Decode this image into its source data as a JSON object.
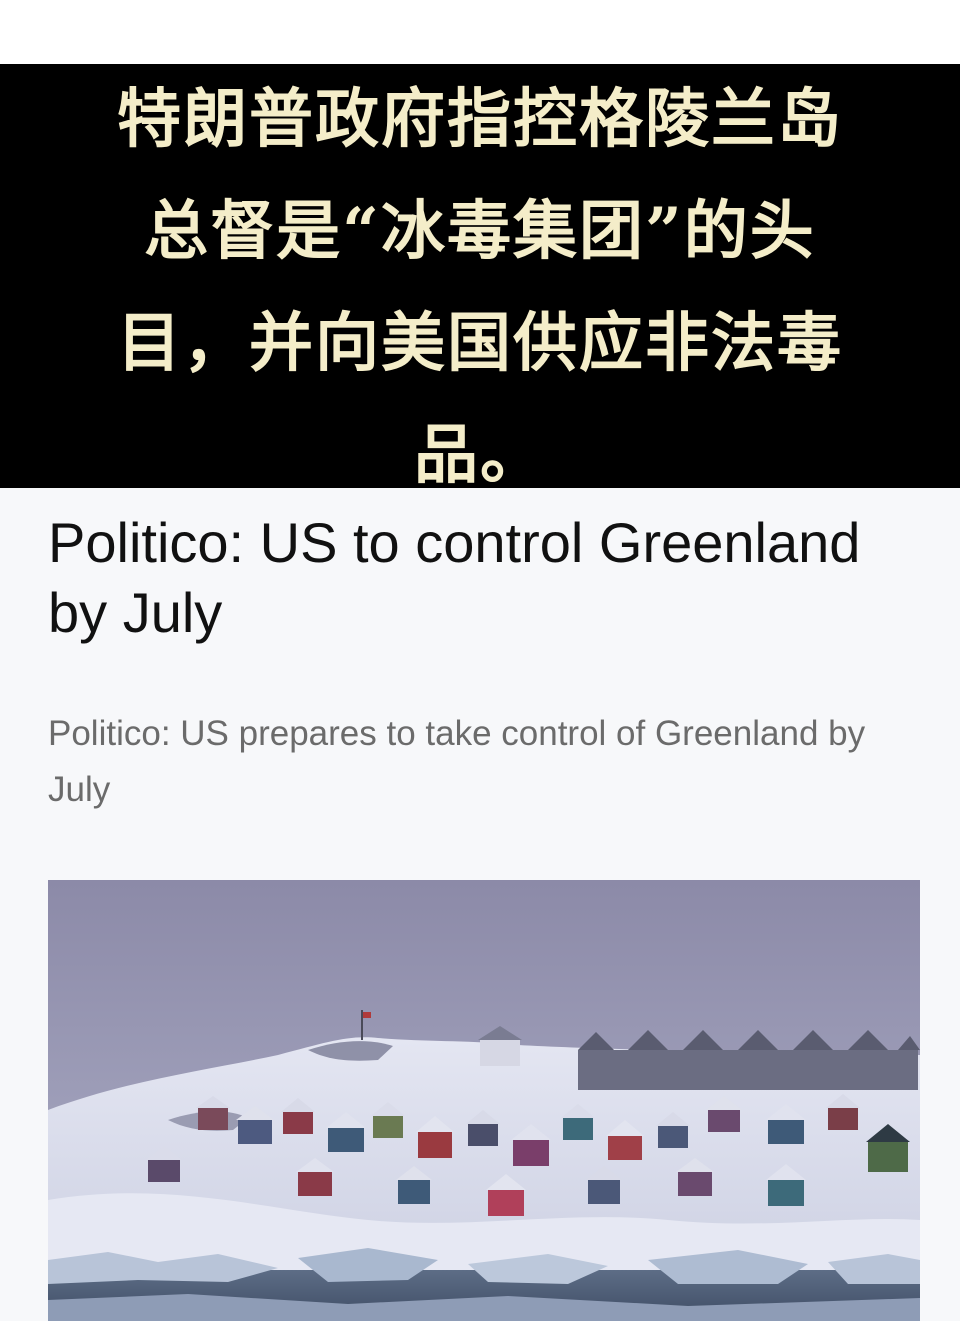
{
  "caption": {
    "lines": [
      "特朗普政府指控格陵兰岛",
      "总督是“冰毒集团”的头",
      "目，并向美国供应非法毒",
      "品。"
    ],
    "text_color": "#f4edc9",
    "background": "#000000"
  },
  "article": {
    "headline": "Politico: US to control Greenland by July",
    "subheadline": "Politico: US prepares to take control of Greenland by July"
  },
  "photo": {
    "subject": "snowy hillside town with colorful houses and ice floes"
  }
}
